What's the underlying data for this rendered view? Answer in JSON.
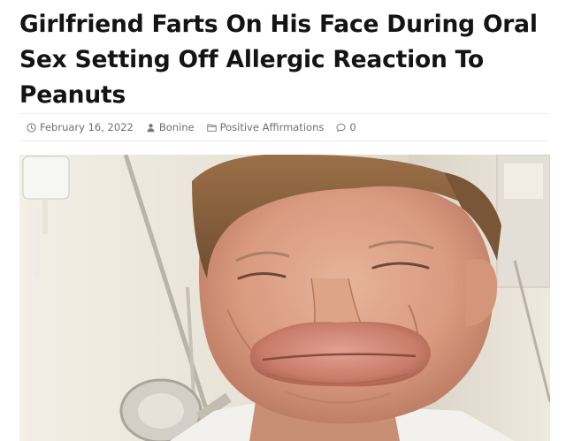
{
  "article": {
    "headline": "Girlfriend Farts On His Face During Oral Sex Setting Off Allergic Reaction To Peanuts",
    "meta": {
      "date": "February 16, 2022",
      "author": "Bonine",
      "category": "Positive Affirmations",
      "comments": "0"
    },
    "image": {
      "icon": "photo-of-man-with-swollen-lips"
    }
  },
  "colors": {
    "headline": "#141414",
    "meta_text": "#6f6f6f",
    "rule": "#ececec"
  },
  "icons": {
    "date": "clock-icon",
    "author": "user-icon",
    "category": "folder-icon",
    "comments": "comment-icon"
  }
}
